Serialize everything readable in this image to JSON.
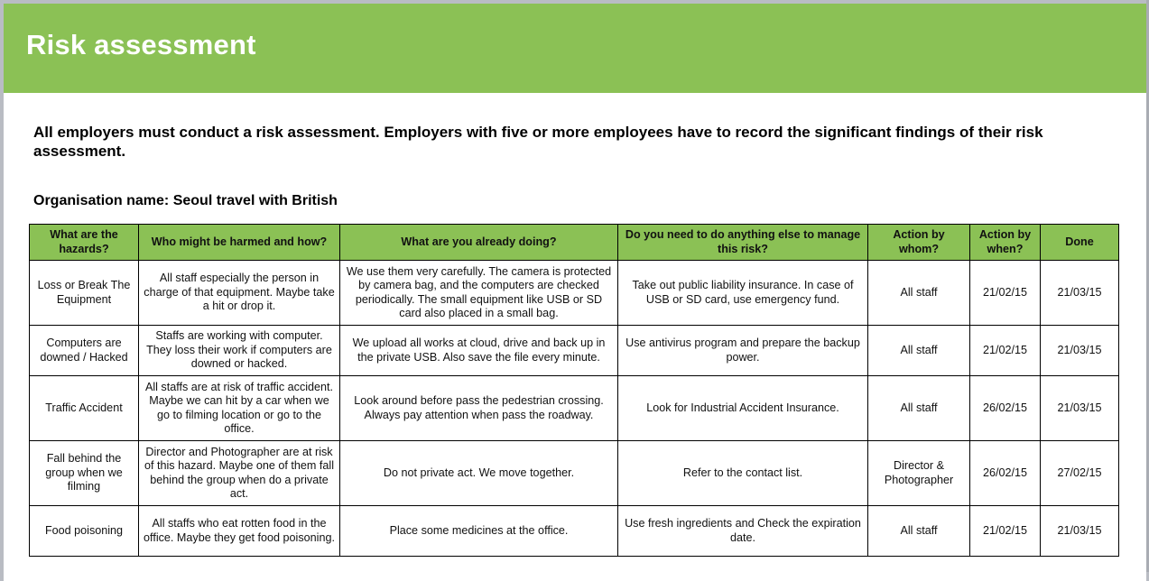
{
  "header": {
    "title": "Risk assessment",
    "accent_color": "#8bc155"
  },
  "intro": "All employers must conduct a risk assessment. Employers with five or more employees have to record the significant findings of their risk assessment.",
  "organisation": {
    "label": "Organisation name:",
    "value": "Seoul travel with British",
    "full": "Organisation name: Seoul travel with British"
  },
  "table": {
    "columns": [
      "What are the hazards?",
      "Who might be harmed and how?",
      "What are you already doing?",
      "Do you need to do anything else to manage this risk?",
      "Action by whom?",
      "Action by when?",
      "Done"
    ],
    "rows": [
      {
        "hazard": "Loss or Break The Equipment",
        "who": "All staff especially the person in charge of that equipment. Maybe take a hit or drop it.",
        "doing": "We use them very carefully. The camera is protected by camera bag, and the computers are checked periodically. The small equipment like USB or SD card also placed in a small bag.",
        "else": "Take out public liability insurance. In case of USB or SD card, use emergency fund.",
        "whom": "All staff",
        "when": "21/02/15",
        "done": "21/03/15"
      },
      {
        "hazard": "Computers are downed / Hacked",
        "who": "Staffs are working with computer. They loss their work if computers are downed or hacked.",
        "doing": "We upload all works at cloud, drive and back up in the private USB. Also save the file every minute.",
        "else": "Use antivirus program and prepare the backup power.",
        "whom": "All staff",
        "when": "21/02/15",
        "done": "21/03/15"
      },
      {
        "hazard": "Traffic Accident",
        "who": "All staffs are at risk of traffic accident. Maybe we can hit by a car when we go to filming location or go to the office.",
        "doing": "Look around before pass the pedestrian crossing. Always pay attention when pass the roadway.",
        "else": "Look for Industrial Accident Insurance.",
        "whom": "All staff",
        "when": "26/02/15",
        "done": "21/03/15"
      },
      {
        "hazard": "Fall behind the group when we filming",
        "who": "Director and Photographer are at risk of this hazard. Maybe one of them fall behind the group when do a private act.",
        "doing": "Do not private act. We move together.",
        "else": "Refer to the contact list.",
        "whom": "Director & Photographer",
        "when": "26/02/15",
        "done": "27/02/15"
      },
      {
        "hazard": "Food poisoning",
        "who": "All staffs who eat rotten food in the office. Maybe they get food poisoning.",
        "doing": "Place some medicines at the office.",
        "else": "Use fresh ingredients and Check the expiration date.",
        "whom": "All staff",
        "when": "21/02/15",
        "done": "21/03/15"
      }
    ]
  }
}
